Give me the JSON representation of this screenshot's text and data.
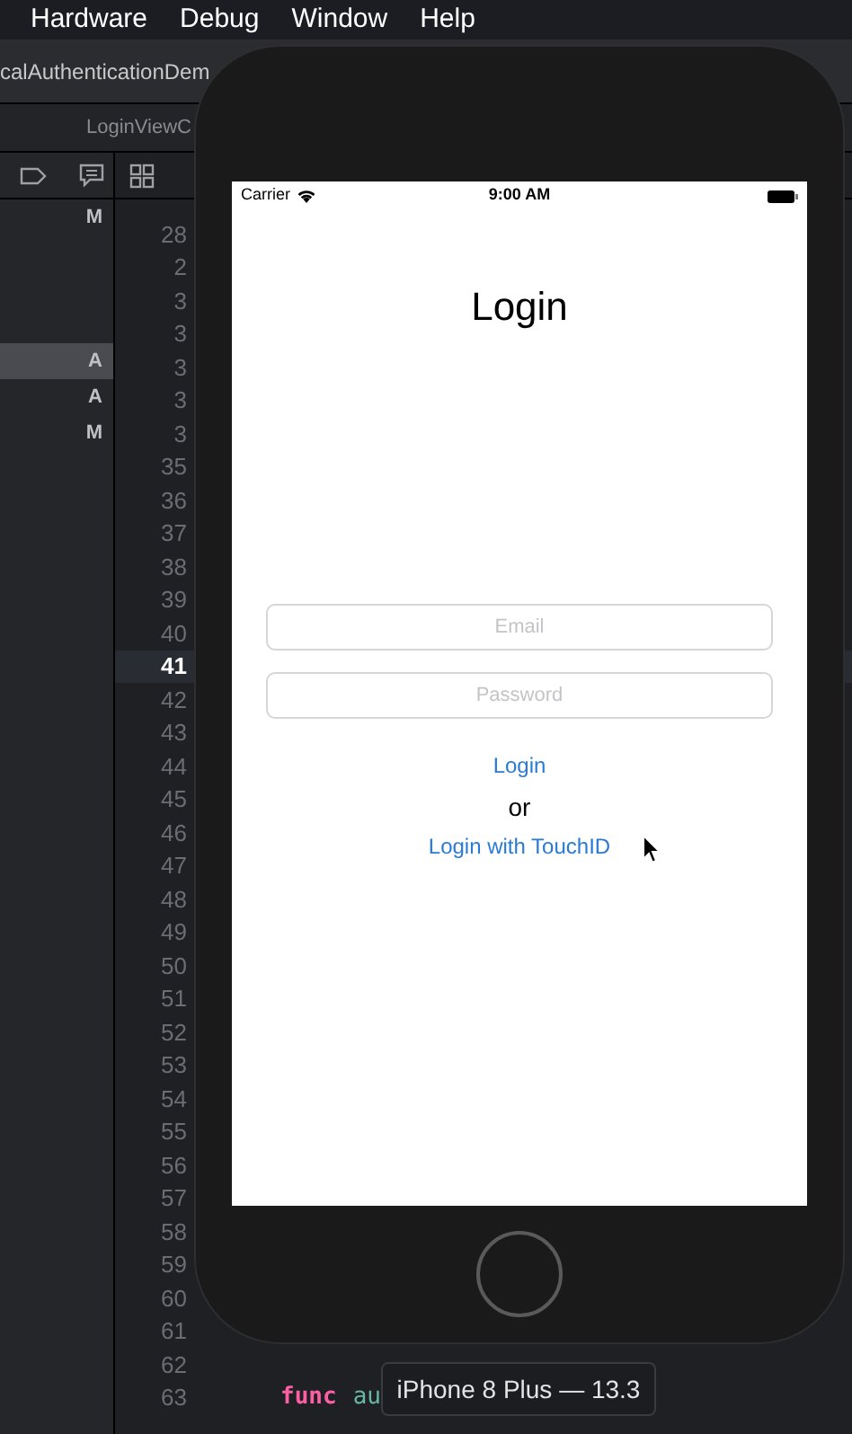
{
  "menu_bar": {
    "items": [
      "Hardware",
      "Debug",
      "Window",
      "Help"
    ]
  },
  "window": {
    "title": "calAuthenticationDem"
  },
  "editor_tab": {
    "title": "LoginViewC"
  },
  "navigator": {
    "rows": [
      {
        "badge": "M",
        "selected": false
      },
      {
        "badge": "A",
        "selected": true
      },
      {
        "badge": "A",
        "selected": false
      },
      {
        "badge": "M",
        "selected": false
      }
    ]
  },
  "editor": {
    "lines": [
      {
        "number": "28",
        "selected": false
      },
      {
        "number": "2",
        "selected": false
      },
      {
        "number": "3",
        "selected": false
      },
      {
        "number": "3",
        "selected": false
      },
      {
        "number": "3",
        "selected": false
      },
      {
        "number": "3",
        "selected": false
      },
      {
        "number": "3",
        "selected": false
      },
      {
        "number": "35",
        "selected": false
      },
      {
        "number": "36",
        "selected": false
      },
      {
        "number": "37",
        "selected": false
      },
      {
        "number": "38",
        "selected": false
      },
      {
        "number": "39",
        "selected": false
      },
      {
        "number": "40",
        "selected": false
      },
      {
        "number": "41",
        "selected": true
      },
      {
        "number": "42",
        "selected": false
      },
      {
        "number": "43",
        "selected": false
      },
      {
        "number": "44",
        "selected": false
      },
      {
        "number": "45",
        "selected": false
      },
      {
        "number": "46",
        "selected": false
      },
      {
        "number": "47",
        "selected": false
      },
      {
        "number": "48",
        "selected": false
      },
      {
        "number": "49",
        "selected": false
      },
      {
        "number": "50",
        "selected": false
      },
      {
        "number": "51",
        "selected": false
      },
      {
        "number": "52",
        "selected": false
      },
      {
        "number": "53",
        "selected": false
      },
      {
        "number": "54",
        "selected": false
      },
      {
        "number": "55",
        "selected": false
      },
      {
        "number": "56",
        "selected": false
      },
      {
        "number": "57",
        "selected": false
      },
      {
        "number": "58",
        "selected": false
      },
      {
        "number": "59",
        "selected": false
      },
      {
        "number": "60",
        "selected": false
      },
      {
        "number": "61",
        "selected": false
      },
      {
        "number": "62",
        "selected": false
      },
      {
        "number": "63",
        "selected": false,
        "code": [
          {
            "kind": "keyword",
            "text": "func"
          },
          {
            "kind": "name",
            "text": "au"
          }
        ]
      }
    ]
  },
  "simulator": {
    "status_bar": {
      "carrier": "Carrier",
      "time": "9:00 AM"
    },
    "title": "Login",
    "fields": [
      {
        "placeholder": "Email"
      },
      {
        "placeholder": "Password"
      }
    ],
    "links": [
      "Login"
    ],
    "separator": "or",
    "touch_link": "Login with TouchID",
    "device_label": "iPhone 8 Plus — 13.3"
  }
}
